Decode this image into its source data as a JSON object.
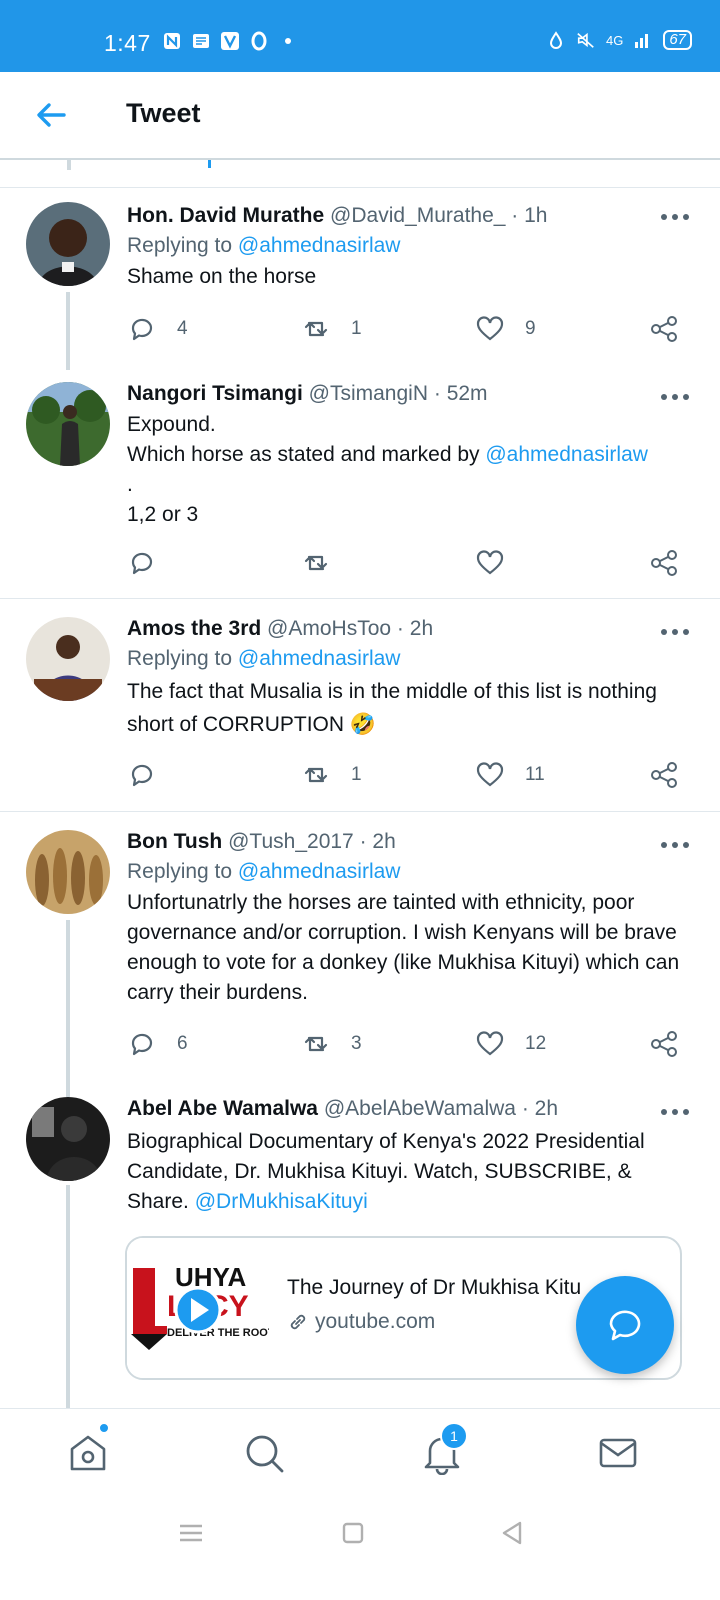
{
  "status_bar": {
    "time": "1:47",
    "network": "4G",
    "battery": "67"
  },
  "header": {
    "title": "Tweet"
  },
  "tweets": [
    {
      "name": "Hon. David Murathe",
      "handle": "@David_Murathe_",
      "time": "1h",
      "replying_label": "Replying to",
      "replying_to": "@ahmednasirlaw",
      "text": "Shame on the horse",
      "replies": "4",
      "retweets": "1",
      "likes": "9"
    },
    {
      "name": "Nangori Tsimangi",
      "handle": "@TsimangiN",
      "time": "52m",
      "text_lines": [
        "Expound.",
        "Which horse as stated and marked by",
        "@ahmednasirlaw",
        ".",
        "1,2 or 3"
      ],
      "replies": "",
      "retweets": "",
      "likes": ""
    },
    {
      "name": "Amos the 3rd",
      "handle": "@AmoHsToo",
      "time": "2h",
      "replying_label": "Replying to",
      "replying_to": "@ahmednasirlaw",
      "text": "The fact that Musalia is in the middle of this list is nothing short of CORRUPTION",
      "emoji": "🤣",
      "replies": "",
      "retweets": "1",
      "likes": "11"
    },
    {
      "name": "Bon Tush",
      "handle": "@Tush_2017",
      "time": "2h",
      "replying_label": "Replying to",
      "replying_to": "@ahmednasirlaw",
      "text": "Unfortunatrly the horses are tainted with ethnicity, poor governance and/or corruption. I wish Kenyans will be brave enough to vote for a donkey (like Mukhisa Kituyi) which can carry their burdens.",
      "replies": "6",
      "retweets": "3",
      "likes": "12"
    },
    {
      "name": "Abel Abe Wamalwa",
      "handle": "@AbelAbeWamalwa",
      "time": "2h",
      "text": "Biographical Documentary of Kenya's 2022 Presidential Candidate, Dr. Mukhisa Kituyi. Watch, SUBSCRIBE, & Share.",
      "mention": "@DrMukhisaKituyi",
      "card": {
        "title": "The Journey of Dr Mukhisa Kitu",
        "domain": "youtube.com",
        "thumb_brand": "LUHYA LEGACY",
        "thumb_tag": "DELIVER THE ROOT"
      }
    }
  ],
  "bottom_nav": {
    "notifications_badge": "1"
  },
  "colors": {
    "accent": "#1d9bf0",
    "statusbar": "#2196e8"
  }
}
